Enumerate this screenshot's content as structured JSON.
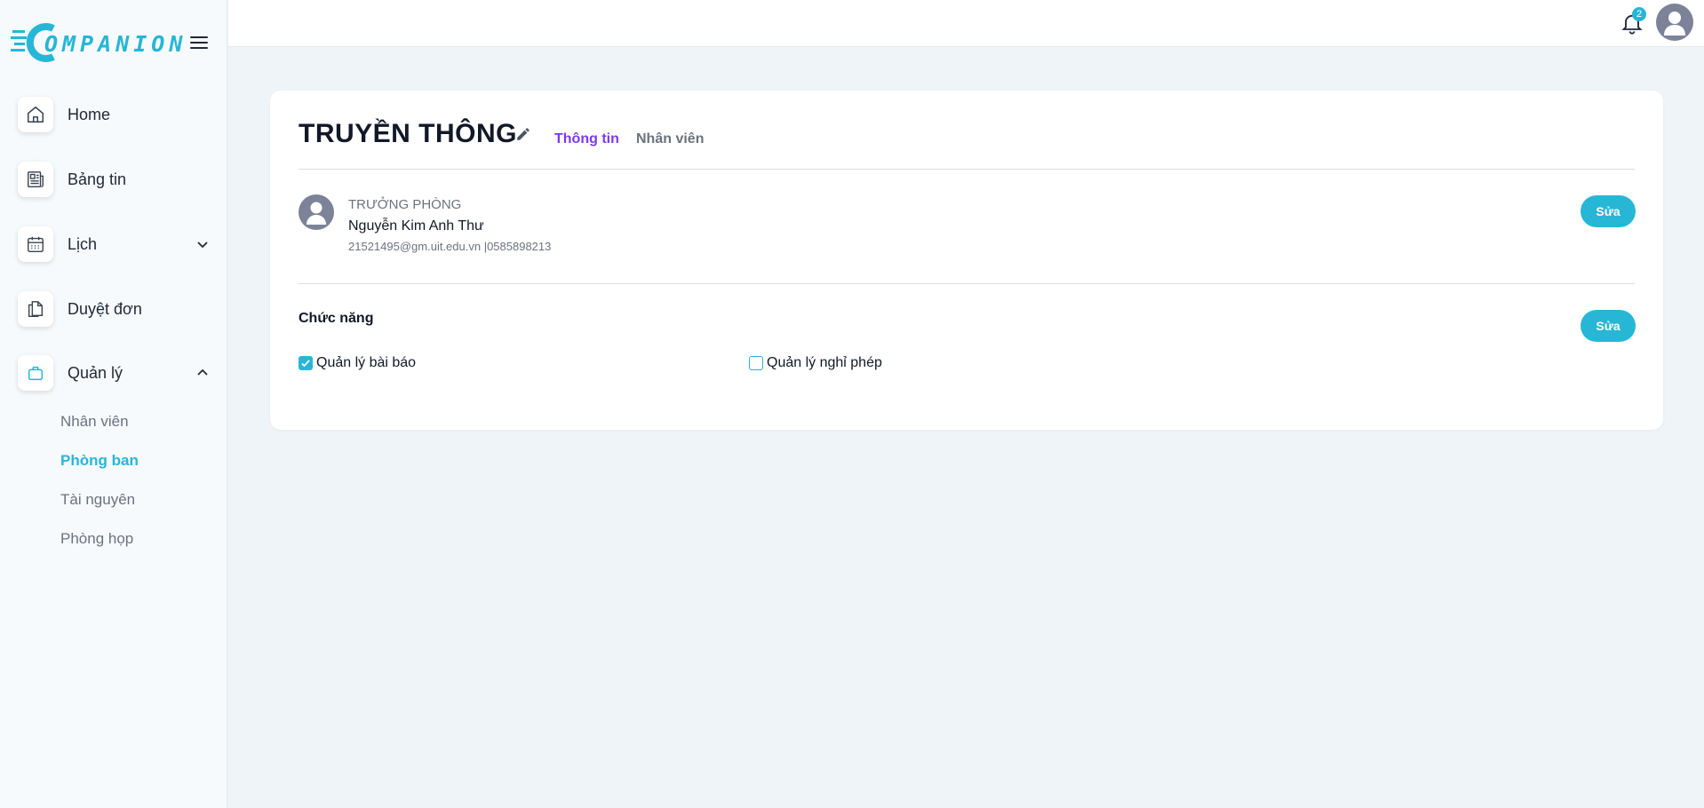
{
  "brand": {
    "logo_text": "OMPANION",
    "accent_color": "#27b6d6"
  },
  "sidebar": {
    "items": [
      {
        "label": "Home",
        "icon": "home-icon"
      },
      {
        "label": "Bảng tin",
        "icon": "newspaper-icon"
      },
      {
        "label": "Lịch",
        "icon": "calendar-icon",
        "expandable": true,
        "expanded": false
      },
      {
        "label": "Duyệt đơn",
        "icon": "document-copy-icon"
      },
      {
        "label": "Quản lý",
        "icon": "briefcase-icon",
        "expandable": true,
        "expanded": true
      }
    ],
    "submenu": [
      {
        "label": "Nhân viên",
        "active": false
      },
      {
        "label": "Phòng ban",
        "active": true
      },
      {
        "label": "Tài nguyên",
        "active": false
      },
      {
        "label": "Phòng họp",
        "active": false
      }
    ]
  },
  "topbar": {
    "notification_count": "2"
  },
  "department": {
    "title": "TRUYỀN THÔNG",
    "tabs": [
      {
        "label": "Thông tin",
        "active": true
      },
      {
        "label": "Nhân viên",
        "active": false
      }
    ],
    "manager": {
      "role": "TRƯỞNG PHÒNG",
      "name": "Nguyễn Kim Anh Thư",
      "contact": "21521495@gm.uit.edu.vn |0585898213",
      "edit_label": "Sửa"
    },
    "functions": {
      "title": "Chức năng",
      "edit_label": "Sửa",
      "items": [
        {
          "label": "Quản lý bài báo",
          "checked": true
        },
        {
          "label": "Quản lý nghỉ phép",
          "checked": false
        }
      ]
    }
  }
}
